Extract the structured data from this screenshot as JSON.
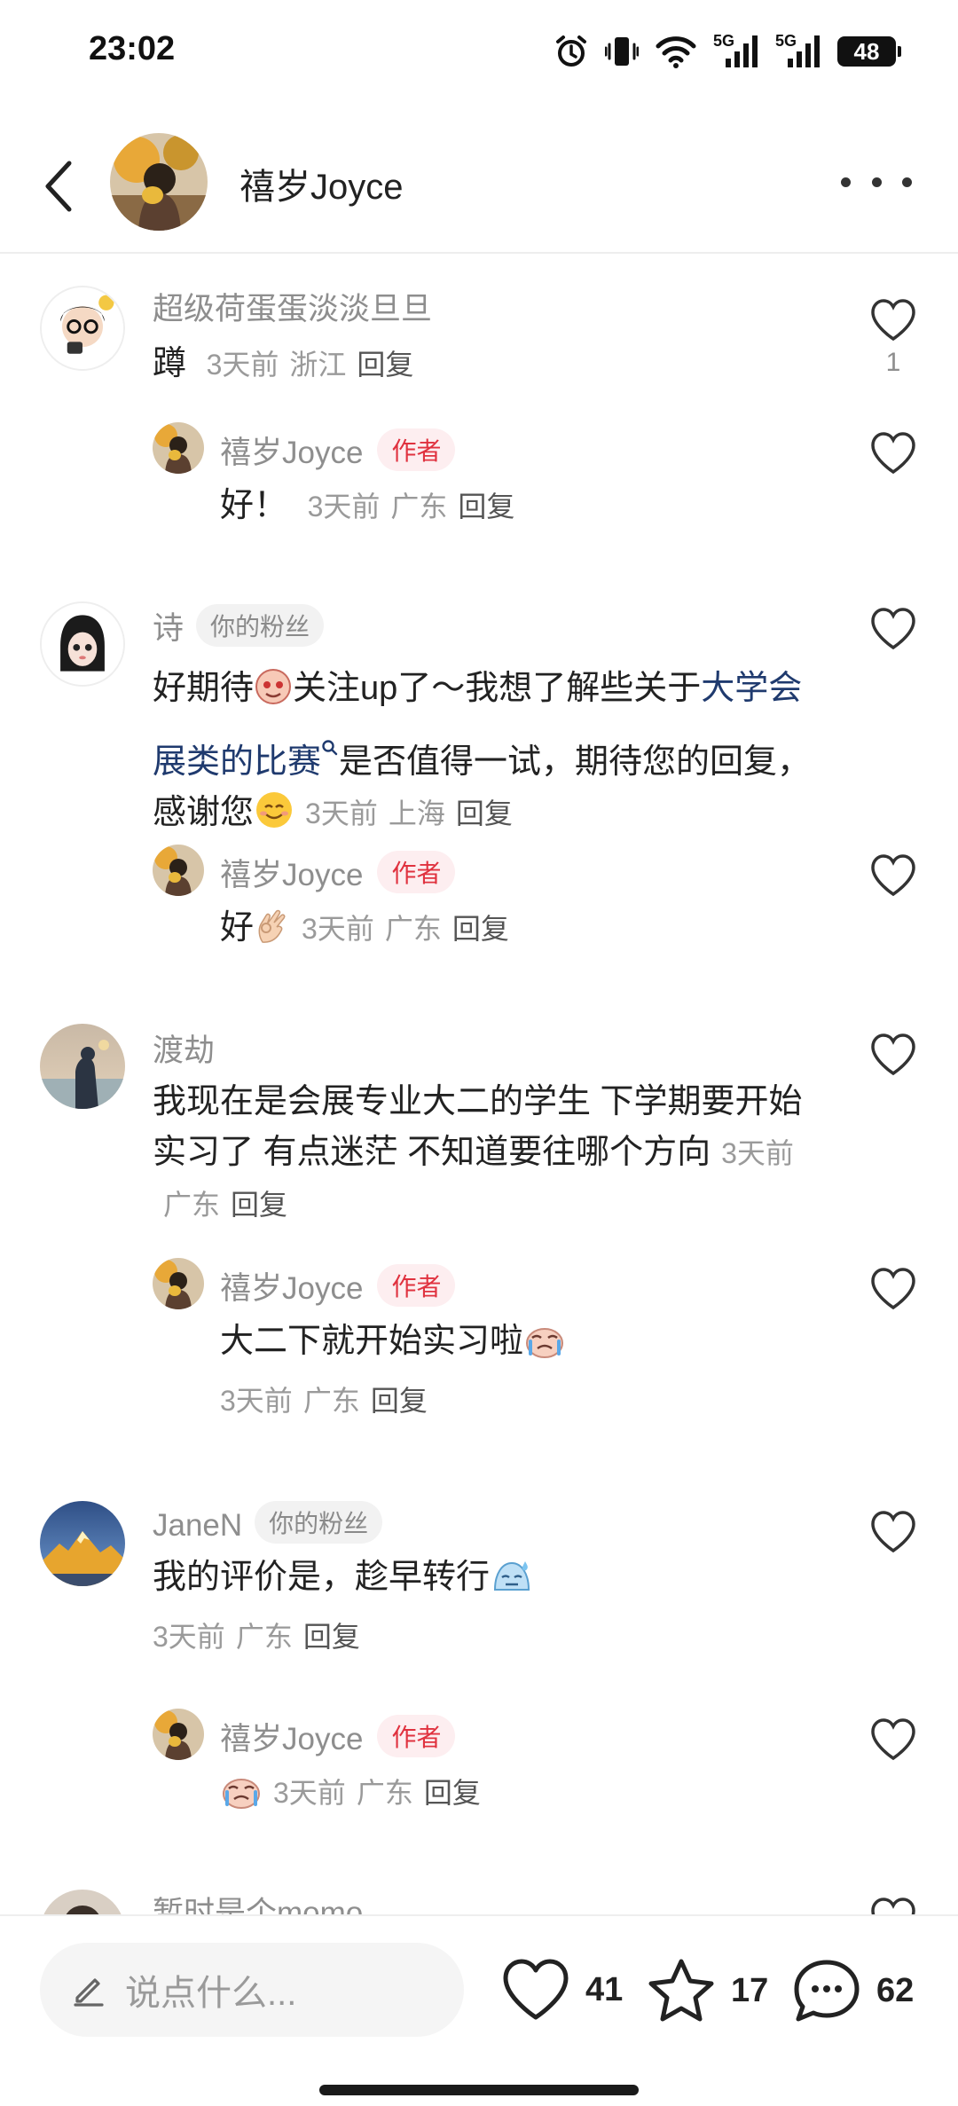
{
  "status_bar": {
    "time": "23:02",
    "battery": "48"
  },
  "header": {
    "user_name": "禧岁Joyce"
  },
  "comments": [
    {
      "user": "超级荷蛋蛋淡淡旦旦",
      "text": "蹲",
      "time": "3天前",
      "location": "浙江",
      "reply": "回复",
      "likes": "1",
      "replies": [
        {
          "user": "禧岁Joyce",
          "badge": "作者",
          "text": "好！",
          "time": "3天前",
          "location": "广东",
          "reply": "回复"
        }
      ]
    },
    {
      "user": "诗",
      "badge": "你的粉丝",
      "text_part1": "好期待",
      "text_part2": "关注up了～我想了解些关于",
      "link": "大学会展类的比赛",
      "text_part3": "是否值得一试，期待您的回复，感谢您",
      "time": "3天前",
      "location": "上海",
      "reply": "回复",
      "replies": [
        {
          "user": "禧岁Joyce",
          "badge": "作者",
          "text": "好",
          "time": "3天前",
          "location": "广东",
          "reply": "回复"
        }
      ]
    },
    {
      "user": "渡劫",
      "text": "我现在是会展专业大二的学生 下学期要开始实习了 有点迷茫 不知道要往哪个方向",
      "time": "3天前",
      "location": "广东",
      "reply": "回复",
      "replies": [
        {
          "user": "禧岁Joyce",
          "badge": "作者",
          "text": "大二下就开始实习啦",
          "time": "3天前",
          "location": "广东",
          "reply": "回复"
        }
      ]
    },
    {
      "user": "JaneN",
      "badge": "你的粉丝",
      "text": "我的评价是，趁早转行",
      "time": "3天前",
      "location": "广东",
      "reply": "回复",
      "replies": [
        {
          "user": "禧岁Joyce",
          "badge": "作者",
          "text": "",
          "time": "3天前",
          "location": "广东",
          "reply": "回复"
        }
      ]
    },
    {
      "user": "暂时是个momo"
    }
  ],
  "bottom_bar": {
    "input_placeholder": "说点什么...",
    "likes": "41",
    "stars": "17",
    "comments": "62"
  }
}
